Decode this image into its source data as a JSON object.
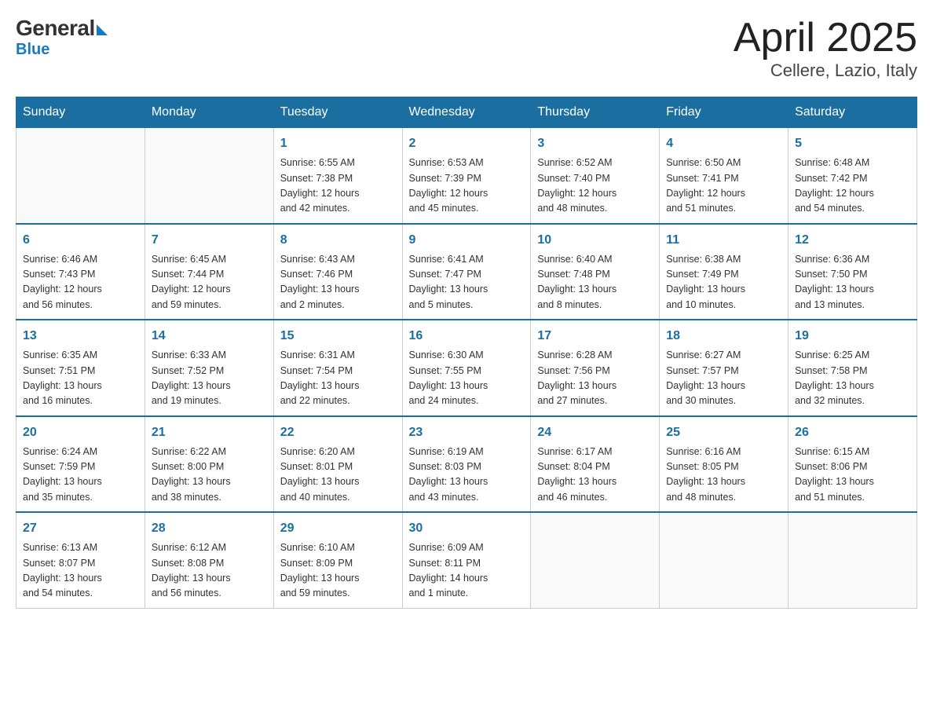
{
  "logo": {
    "general": "General",
    "blue": "Blue"
  },
  "header": {
    "month": "April 2025",
    "location": "Cellere, Lazio, Italy"
  },
  "weekdays": [
    "Sunday",
    "Monday",
    "Tuesday",
    "Wednesday",
    "Thursday",
    "Friday",
    "Saturday"
  ],
  "weeks": [
    [
      {
        "day": "",
        "info": ""
      },
      {
        "day": "",
        "info": ""
      },
      {
        "day": "1",
        "info": "Sunrise: 6:55 AM\nSunset: 7:38 PM\nDaylight: 12 hours\nand 42 minutes."
      },
      {
        "day": "2",
        "info": "Sunrise: 6:53 AM\nSunset: 7:39 PM\nDaylight: 12 hours\nand 45 minutes."
      },
      {
        "day": "3",
        "info": "Sunrise: 6:52 AM\nSunset: 7:40 PM\nDaylight: 12 hours\nand 48 minutes."
      },
      {
        "day": "4",
        "info": "Sunrise: 6:50 AM\nSunset: 7:41 PM\nDaylight: 12 hours\nand 51 minutes."
      },
      {
        "day": "5",
        "info": "Sunrise: 6:48 AM\nSunset: 7:42 PM\nDaylight: 12 hours\nand 54 minutes."
      }
    ],
    [
      {
        "day": "6",
        "info": "Sunrise: 6:46 AM\nSunset: 7:43 PM\nDaylight: 12 hours\nand 56 minutes."
      },
      {
        "day": "7",
        "info": "Sunrise: 6:45 AM\nSunset: 7:44 PM\nDaylight: 12 hours\nand 59 minutes."
      },
      {
        "day": "8",
        "info": "Sunrise: 6:43 AM\nSunset: 7:46 PM\nDaylight: 13 hours\nand 2 minutes."
      },
      {
        "day": "9",
        "info": "Sunrise: 6:41 AM\nSunset: 7:47 PM\nDaylight: 13 hours\nand 5 minutes."
      },
      {
        "day": "10",
        "info": "Sunrise: 6:40 AM\nSunset: 7:48 PM\nDaylight: 13 hours\nand 8 minutes."
      },
      {
        "day": "11",
        "info": "Sunrise: 6:38 AM\nSunset: 7:49 PM\nDaylight: 13 hours\nand 10 minutes."
      },
      {
        "day": "12",
        "info": "Sunrise: 6:36 AM\nSunset: 7:50 PM\nDaylight: 13 hours\nand 13 minutes."
      }
    ],
    [
      {
        "day": "13",
        "info": "Sunrise: 6:35 AM\nSunset: 7:51 PM\nDaylight: 13 hours\nand 16 minutes."
      },
      {
        "day": "14",
        "info": "Sunrise: 6:33 AM\nSunset: 7:52 PM\nDaylight: 13 hours\nand 19 minutes."
      },
      {
        "day": "15",
        "info": "Sunrise: 6:31 AM\nSunset: 7:54 PM\nDaylight: 13 hours\nand 22 minutes."
      },
      {
        "day": "16",
        "info": "Sunrise: 6:30 AM\nSunset: 7:55 PM\nDaylight: 13 hours\nand 24 minutes."
      },
      {
        "day": "17",
        "info": "Sunrise: 6:28 AM\nSunset: 7:56 PM\nDaylight: 13 hours\nand 27 minutes."
      },
      {
        "day": "18",
        "info": "Sunrise: 6:27 AM\nSunset: 7:57 PM\nDaylight: 13 hours\nand 30 minutes."
      },
      {
        "day": "19",
        "info": "Sunrise: 6:25 AM\nSunset: 7:58 PM\nDaylight: 13 hours\nand 32 minutes."
      }
    ],
    [
      {
        "day": "20",
        "info": "Sunrise: 6:24 AM\nSunset: 7:59 PM\nDaylight: 13 hours\nand 35 minutes."
      },
      {
        "day": "21",
        "info": "Sunrise: 6:22 AM\nSunset: 8:00 PM\nDaylight: 13 hours\nand 38 minutes."
      },
      {
        "day": "22",
        "info": "Sunrise: 6:20 AM\nSunset: 8:01 PM\nDaylight: 13 hours\nand 40 minutes."
      },
      {
        "day": "23",
        "info": "Sunrise: 6:19 AM\nSunset: 8:03 PM\nDaylight: 13 hours\nand 43 minutes."
      },
      {
        "day": "24",
        "info": "Sunrise: 6:17 AM\nSunset: 8:04 PM\nDaylight: 13 hours\nand 46 minutes."
      },
      {
        "day": "25",
        "info": "Sunrise: 6:16 AM\nSunset: 8:05 PM\nDaylight: 13 hours\nand 48 minutes."
      },
      {
        "day": "26",
        "info": "Sunrise: 6:15 AM\nSunset: 8:06 PM\nDaylight: 13 hours\nand 51 minutes."
      }
    ],
    [
      {
        "day": "27",
        "info": "Sunrise: 6:13 AM\nSunset: 8:07 PM\nDaylight: 13 hours\nand 54 minutes."
      },
      {
        "day": "28",
        "info": "Sunrise: 6:12 AM\nSunset: 8:08 PM\nDaylight: 13 hours\nand 56 minutes."
      },
      {
        "day": "29",
        "info": "Sunrise: 6:10 AM\nSunset: 8:09 PM\nDaylight: 13 hours\nand 59 minutes."
      },
      {
        "day": "30",
        "info": "Sunrise: 6:09 AM\nSunset: 8:11 PM\nDaylight: 14 hours\nand 1 minute."
      },
      {
        "day": "",
        "info": ""
      },
      {
        "day": "",
        "info": ""
      },
      {
        "day": "",
        "info": ""
      }
    ]
  ]
}
